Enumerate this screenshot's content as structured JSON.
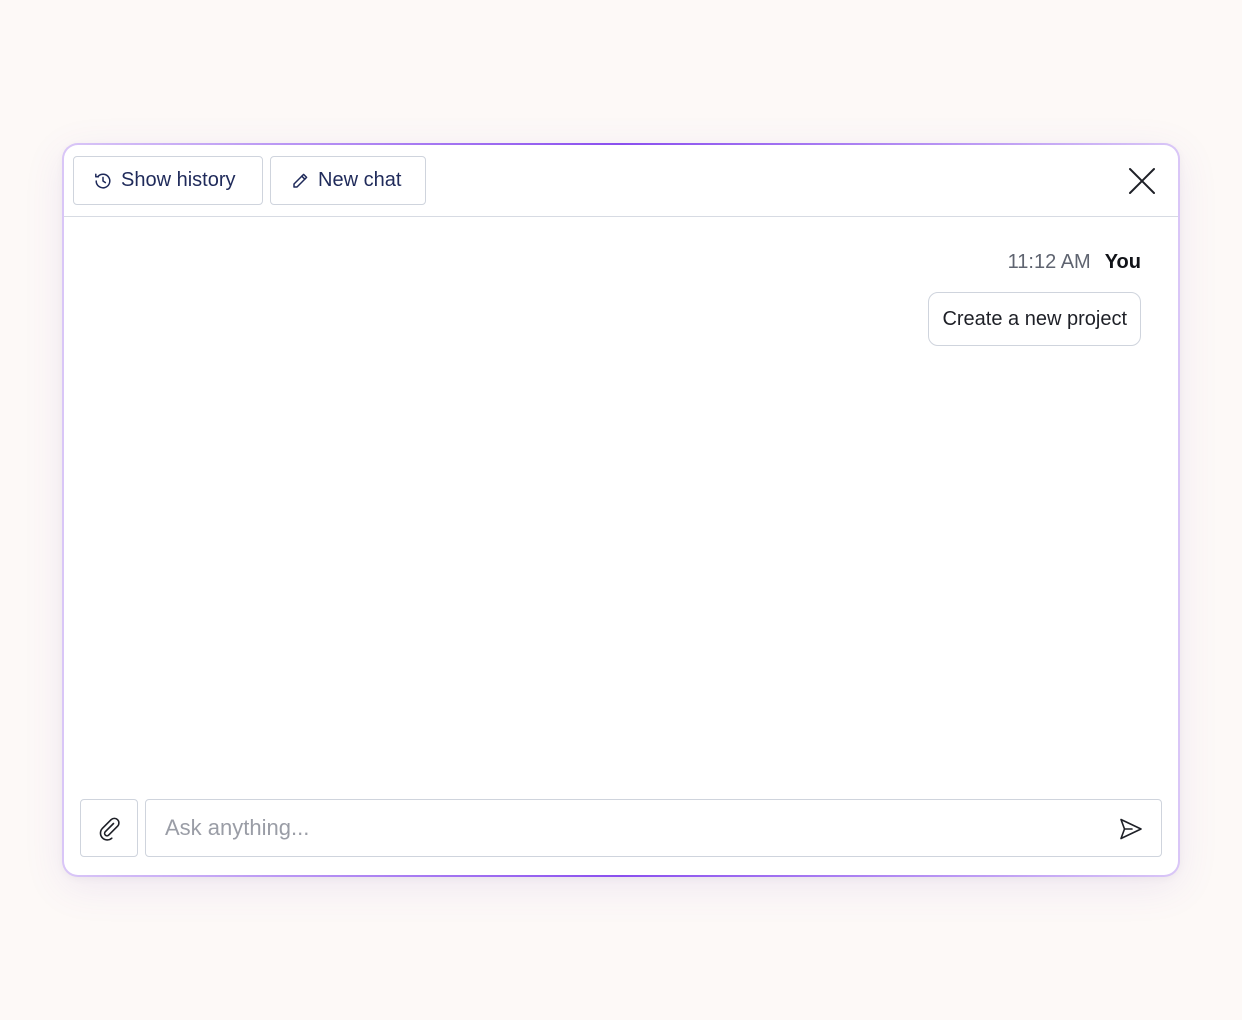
{
  "header": {
    "show_history_label": "Show history",
    "show_history_icon": "history-clock-icon",
    "new_chat_label": "New chat",
    "new_chat_icon": "pencil-icon",
    "close_icon": "close-icon"
  },
  "messages": [
    {
      "time": "11:12 AM",
      "sender": "You",
      "text": "Create a new project"
    }
  ],
  "composer": {
    "placeholder": "Ask anything...",
    "value": "",
    "attach_icon": "paperclip-icon",
    "send_icon": "send-icon"
  },
  "colors": {
    "accent": "#7c3aed",
    "button_text": "#1f2a5a",
    "border": "#cfd4dd",
    "background": "#fdf9f7"
  }
}
